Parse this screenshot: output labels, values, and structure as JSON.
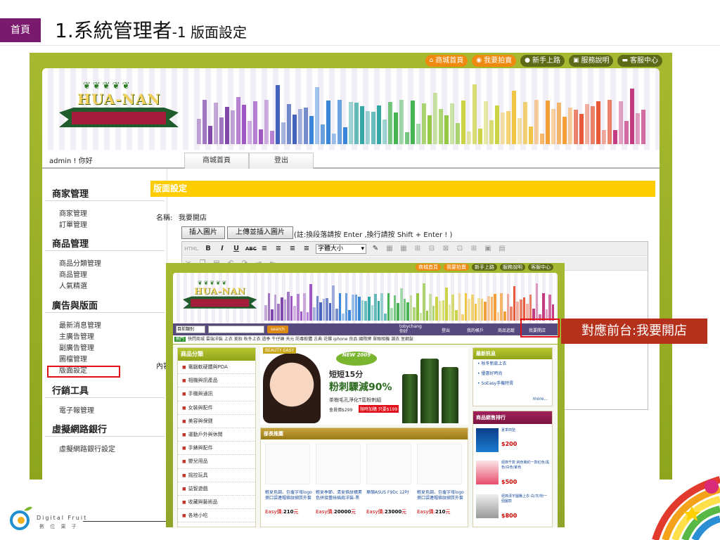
{
  "slide": {
    "home_tab": "首頁",
    "title_main": "1.系統管理者",
    "title_sub": "-1 版面設定",
    "callout": "對應前台:我要開店",
    "footer_brand": "Digital Fruit",
    "footer_brand_cn": "數 位 果 子"
  },
  "admin": {
    "top_nav": [
      {
        "label": "商城首頁",
        "icon": "home-icon",
        "style": "orange"
      },
      {
        "label": "我要拍賣",
        "icon": "auction-icon",
        "style": "orange"
      },
      {
        "label": "新手上路",
        "icon": "person-icon",
        "style": "dark"
      },
      {
        "label": "服務說明",
        "icon": "info-icon",
        "style": "dark"
      },
      {
        "label": "客服中心",
        "icon": "chat-icon",
        "style": "dark"
      }
    ],
    "logo_text": "HUA-NAN",
    "greeting": "admin ! 你好",
    "tabs": [
      "商城首頁",
      "登出"
    ],
    "sidebar": [
      {
        "heading": "商家管理",
        "items": [
          "商家管理",
          "訂單管理"
        ]
      },
      {
        "heading": "商品管理",
        "items": [
          "商品分類管理",
          "商品管理",
          "人氣精選"
        ]
      },
      {
        "heading": "廣告與版面",
        "items": [
          "最新消息管理",
          "主廣告管理",
          "副廣告管理",
          "圖檔管理",
          "版面設定"
        ]
      },
      {
        "heading": "行銷工具",
        "items": [
          "電子報管理"
        ]
      },
      {
        "heading": "虛擬網路銀行",
        "items": [
          "虛擬網路銀行設定"
        ]
      }
    ],
    "panel_title": "版面設定",
    "name_label": "名稱:",
    "name_value": "我要開店",
    "content_label": "內容",
    "btn_insert_image": "插入圖片",
    "btn_upload_image": "上傳並插入圖片",
    "note": "(註:換段落請按 Enter ,換行請按 Shift + Enter ! )",
    "font_size_select": "字體大小"
  },
  "front": {
    "top_nav": [
      {
        "label": "商城首頁",
        "style": "orange"
      },
      {
        "label": "我要拍賣",
        "style": "orange"
      },
      {
        "label": "新手上路",
        "style": "dark"
      },
      {
        "label": "服務說明",
        "style": "dark"
      },
      {
        "label": "客服中心",
        "style": "dark"
      }
    ],
    "select": "目前類別",
    "search_btn": "search",
    "user": "tobychang",
    "user_hello": "你好",
    "nav_links": [
      "登出",
      "我的帳戶",
      "商品追蹤",
      "我要開店"
    ],
    "hot_label": "熱門",
    "hot_links": "快閃商城 雲端洋裝 上衣 美妝 秋冬上衣 過季 牛仔褲 天元 防毒軟體 古典 花蝶 iphone 良品 國際牌 單眼相機 潮衣 室鋼髮",
    "category_heading": "商品分類",
    "categories": [
      "電腦軟硬體與PDA",
      "相機與訊產品",
      "手機與通訊",
      "女裝與配件",
      "美容與保健",
      "運動戶外與休閒",
      "手錶與配件",
      "嬰兒用品",
      "摇控玩具",
      "益智遊戲",
      "收藏與藝術品",
      "各地小吃"
    ],
    "hero": {
      "tag": "BEAUTY EASY",
      "new": "NEW 2009",
      "line1": "短短15分",
      "line2": "粉刺驟減90%",
      "line3": "茶樹毛孔淨化T區粉刺組",
      "line4": "會員價$299",
      "line5": "限時加購 只要$199"
    },
    "rec_heading": "部長推薦",
    "products": [
      {
        "title": "輕夏色調、包覆字母logo側口袋連帽條紋細質外套",
        "price": "210"
      },
      {
        "title": "輕夏季節、清夏條紋橫素色拼接蕾絲插肩洋裝-黑",
        "price": "20000"
      },
      {
        "title": "華碩ASUS F9Dc 12吋",
        "price": "23000"
      },
      {
        "title": "輕夏色調、包覆字母logo側口袋連帽條紋細質外套",
        "price": "210"
      }
    ],
    "price_prefix": "Easy價:",
    "price_unit": "元",
    "news_heading": "最新訊息",
    "news": [
      "秋冬新款上衣",
      "優惠好時尚",
      "SoEasy手機特賣"
    ],
    "news_more": "more...",
    "rank_heading": "商品銷售排行",
    "ranks": [
      {
        "title": "夏季田墊",
        "price": "$200"
      },
      {
        "title": "經典千款 純色簡約一款紅色/黑色/白色/紫色",
        "price": "$500"
      },
      {
        "title": "經典漢字圖騰上衣-白/灰/粉一個圖款",
        "price": "$800"
      }
    ]
  },
  "colors": {
    "accent_purple": "#7a1a6e",
    "callout_red": "#b5311c",
    "highlight_red": "#e0111b",
    "panel_yellow": "#ffcc00",
    "frame_green": "#9db22a",
    "nav_purple": "#55497e"
  }
}
